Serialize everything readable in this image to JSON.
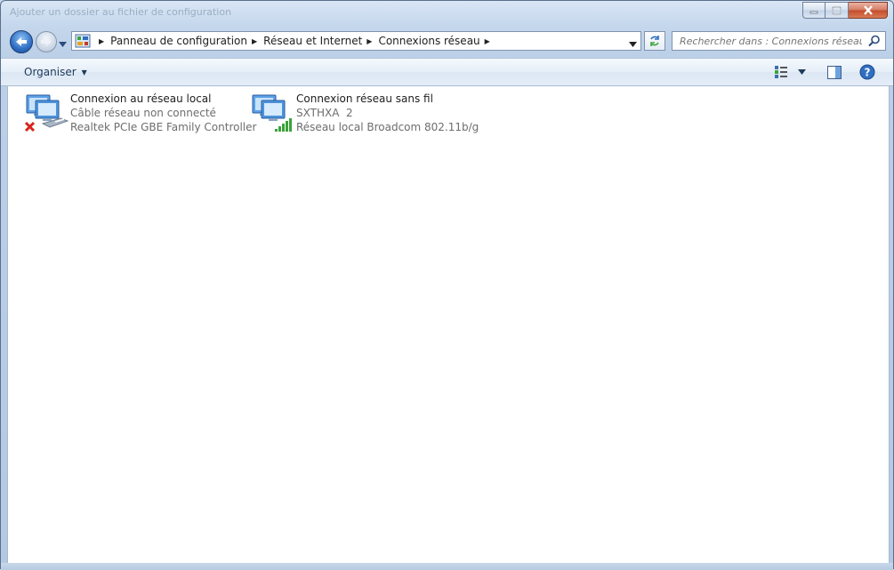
{
  "window": {
    "title": "Ajouter un dossier au fichier de configuration"
  },
  "navigation": {
    "breadcrumbs": [
      {
        "label": "Panneau de configuration"
      },
      {
        "label": "Réseau et Internet"
      },
      {
        "label": "Connexions réseau"
      }
    ]
  },
  "search": {
    "placeholder": "Rechercher dans : Connexions réseau"
  },
  "toolbar": {
    "organise_label": "Organiser"
  },
  "connections": [
    {
      "name": "Connexion au réseau local",
      "status": "Câble réseau non connecté",
      "adapter": "Realtek PCIe GBE Family Controller",
      "icon": "network-disconnected-icon"
    },
    {
      "name": "Connexion réseau sans fil",
      "status": "SXTHXA  2",
      "adapter": "Réseau local Broadcom 802.11b/g",
      "icon": "wireless-signal-icon"
    }
  ],
  "colors": {
    "accent": "#2f6fc3",
    "error_red": "#d8231d",
    "signal_green": "#3aa33a"
  }
}
